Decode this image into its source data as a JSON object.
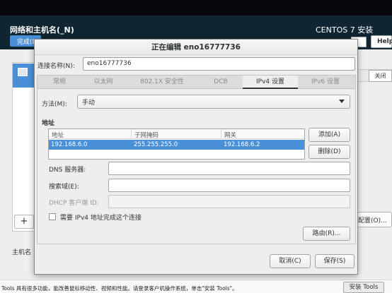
{
  "installer": {
    "spoke_title": "网络和主机名(_N)",
    "done_label": "完成(D)",
    "product": "CENTOS 7 安装",
    "help_label": "Help!",
    "add_interface_label": "+",
    "off_label": "关闭",
    "configure_label": "配置(O)...",
    "hostname_label": "主机名"
  },
  "dialog": {
    "title": "正在编辑 eno16777736",
    "conn_name_label": "连接名称(N):",
    "conn_name_value": "eno16777736",
    "tabs": [
      {
        "label": "常规"
      },
      {
        "label": "以太网"
      },
      {
        "label": "802.1X 安全性"
      },
      {
        "label": "DCB"
      },
      {
        "label": "IPv4 设置"
      },
      {
        "label": "IPv6 设置"
      }
    ],
    "active_tab": "IPv4 设置",
    "method_label": "方法(M):",
    "method_value": "手动",
    "address_section": "地址",
    "columns": {
      "address": "地址",
      "netmask": "子网掩码",
      "gateway": "网关"
    },
    "addresses": [
      {
        "address": "192.168.6.0",
        "netmask": "255.255.255.0",
        "gateway": "192.168.6.2"
      }
    ],
    "add_label": "添加(A)",
    "delete_label": "删除(D)",
    "dns_label": "DNS 服务器:",
    "dns_value": "",
    "search_label": "搜索域(E):",
    "search_value": "",
    "dhcp_label": "DHCP 客户端 ID:",
    "dhcp_value": "",
    "require_ipv4_label": "需要 IPv4 地址完成这个连接",
    "require_ipv4_checked": false,
    "routes_label": "路由(R)...",
    "cancel_label": "取消(C)",
    "save_label": "保存(S)"
  },
  "vm_bar": {
    "message": "Tools 具有很多功能，能改善鼠标移动性、视频和性能。请登录客户机操作系统，单击\"安装 Tools\"。",
    "install_tools_label": "安装 Tools"
  },
  "colors": {
    "selection": "#4a90d9",
    "header_bg": "#0f2632"
  }
}
